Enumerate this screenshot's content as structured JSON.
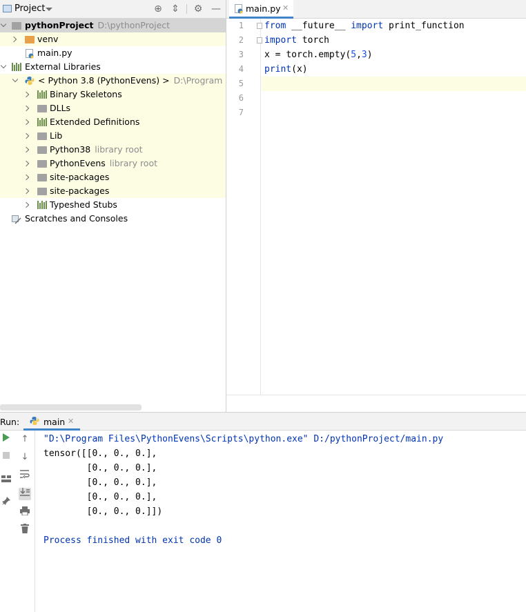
{
  "project": {
    "header_title": "Project",
    "tree": [
      {
        "label": "pythonProject",
        "hint": "D:\\pythonProject",
        "icon": "folder-icon"
      },
      {
        "label": "venv",
        "hint": "",
        "icon": "folder-icon"
      },
      {
        "label": "main.py",
        "hint": "",
        "icon": "python-file-icon"
      },
      {
        "label": "External Libraries",
        "hint": "",
        "icon": "library-icon"
      },
      {
        "label": "< Python 3.8 (PythonEvens) >",
        "hint": "D:\\Program Files",
        "icon": "python-sdk-icon"
      },
      {
        "label": "Binary Skeletons",
        "hint": "",
        "icon": "library-icon"
      },
      {
        "label": "DLLs",
        "hint": "",
        "icon": "folder-icon"
      },
      {
        "label": "Extended Definitions",
        "hint": "",
        "icon": "library-icon"
      },
      {
        "label": "Lib",
        "hint": "",
        "icon": "folder-icon"
      },
      {
        "label": "Python38",
        "hint": "library root",
        "icon": "folder-icon"
      },
      {
        "label": "PythonEvens",
        "hint": "library root",
        "icon": "folder-icon"
      },
      {
        "label": "site-packages",
        "hint": "",
        "icon": "folder-icon"
      },
      {
        "label": "site-packages",
        "hint": "",
        "icon": "folder-icon"
      },
      {
        "label": "Typeshed Stubs",
        "hint": "",
        "icon": "library-icon"
      },
      {
        "label": "Scratches and Consoles",
        "hint": "",
        "icon": "scratch-icon"
      }
    ]
  },
  "editor": {
    "tab_label": "main.py",
    "line_numbers": [
      "1",
      "2",
      "3",
      "4",
      "5",
      "6",
      "7"
    ],
    "code": [
      [
        {
          "t": "from",
          "c": "kw"
        },
        {
          "t": " __future__ ",
          "c": ""
        },
        {
          "t": "import",
          "c": "kw"
        },
        {
          "t": " print_function",
          "c": ""
        }
      ],
      [
        {
          "t": "import",
          "c": "kw"
        },
        {
          "t": " torch",
          "c": ""
        }
      ],
      [
        {
          "t": "x = ",
          "c": ""
        },
        {
          "t": "torch.empty(",
          "c": ""
        },
        {
          "t": "5",
          "c": "num"
        },
        {
          "t": ",",
          "c": ""
        },
        {
          "t": "3",
          "c": "num"
        },
        {
          "t": ")",
          "c": ""
        }
      ],
      [
        {
          "t": "print",
          "c": "kw"
        },
        {
          "t": "(x)",
          "c": ""
        }
      ],
      [],
      [],
      []
    ]
  },
  "run": {
    "label": "Run:",
    "tab_label": "main",
    "console": [
      {
        "text": "\"D:\\Program Files\\PythonEvens\\Scripts\\python.exe\" D:/pythonProject/main.py",
        "style": "blue"
      },
      {
        "text": "tensor([[0., 0., 0.],",
        "style": ""
      },
      {
        "text": "        [0., 0., 0.],",
        "style": ""
      },
      {
        "text": "        [0., 0., 0.],",
        "style": ""
      },
      {
        "text": "        [0., 0., 0.],",
        "style": ""
      },
      {
        "text": "        [0., 0., 0.]])",
        "style": ""
      },
      {
        "text": "",
        "style": ""
      },
      {
        "text": "Process finished with exit code 0",
        "style": "blue"
      }
    ]
  },
  "colors": {
    "accent": "#4083c9",
    "keyword": "#0033b3",
    "number": "#1750eb",
    "highlight_row": "#fdfde4",
    "selected_row": "#d5d5d5",
    "run_green": "#499c54"
  }
}
